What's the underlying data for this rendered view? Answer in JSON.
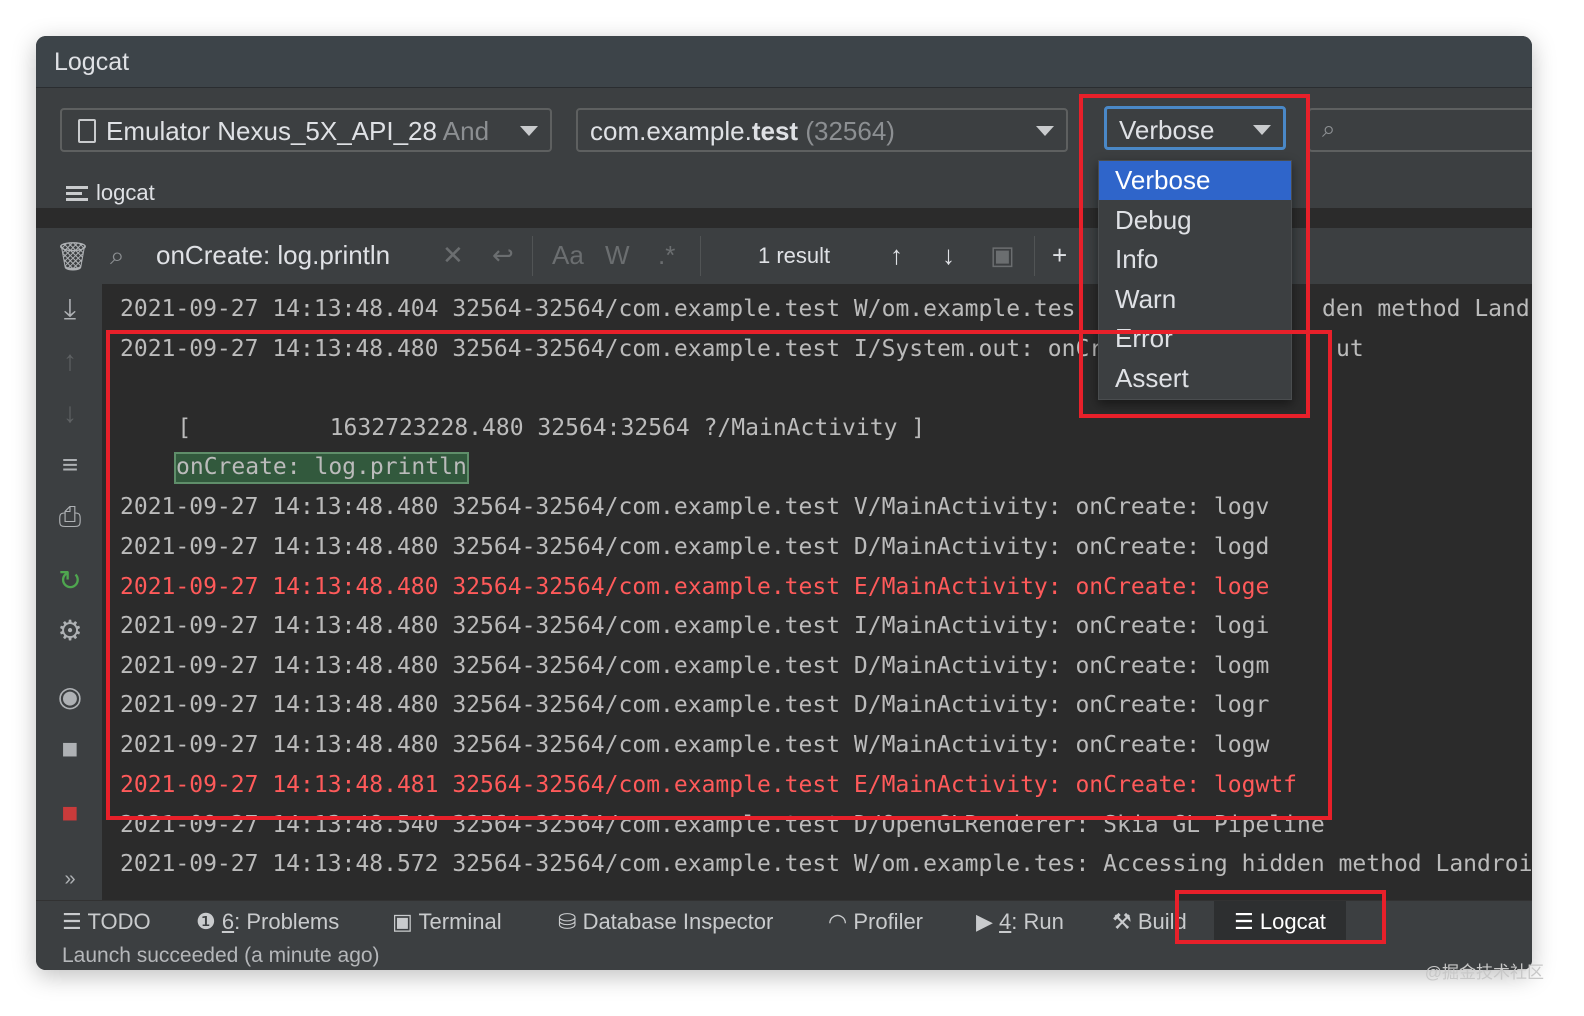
{
  "window": {
    "title": "Logcat"
  },
  "toolbar": {
    "device": "Emulator Nexus_5X_API_28",
    "device_suffix": "And",
    "process_pkg": "com.example.",
    "process_bold": "test",
    "process_pid": "(32564)",
    "log_level": "Verbose"
  },
  "tab": {
    "label": "logcat"
  },
  "search": {
    "query": "onCreate: log.println",
    "match_case": "Aa",
    "words": "W",
    "regex": ".*",
    "results": "1 result"
  },
  "dropdown": {
    "items": [
      "Verbose",
      "Debug",
      "Info",
      "Warn",
      "Error",
      "Assert"
    ],
    "selected": "Verbose"
  },
  "log": {
    "lines": [
      "2021-09-27 14:13:48.404 32564-32564/com.example.test W/om.example.tes",
      "2021-09-27 14:13:48.480 32564-32564/com.example.test I/System.out: onCr",
      "",
      "    [          1632723228.480 32564:32564 ?/MainActivity ]",
      "onCreate: log.println",
      "2021-09-27 14:13:48.480 32564-32564/com.example.test V/MainActivity: onCreate: logv",
      "2021-09-27 14:13:48.480 32564-32564/com.example.test D/MainActivity: onCreate: logd",
      "2021-09-27 14:13:48.480 32564-32564/com.example.test E/MainActivity: onCreate: loge",
      "2021-09-27 14:13:48.480 32564-32564/com.example.test I/MainActivity: onCreate: logi",
      "2021-09-27 14:13:48.480 32564-32564/com.example.test D/MainActivity: onCreate: logm",
      "2021-09-27 14:13:48.480 32564-32564/com.example.test D/MainActivity: onCreate: logr",
      "2021-09-27 14:13:48.480 32564-32564/com.example.test W/MainActivity: onCreate: logw",
      "2021-09-27 14:13:48.481 32564-32564/com.example.test E/MainActivity: onCreate: logwtf",
      "2021-09-27 14:13:48.540 32564-32564/com.example.test D/OpenGLRenderer: Skia GL Pipeline",
      "2021-09-27 14:13:48.572 32564-32564/com.example.test W/om.example.tes: Accessing hidden method Landroi"
    ],
    "line0_tail": "den method Landroi",
    "line1_tail": "ut"
  },
  "bottom_tabs": {
    "todo": "TODO",
    "problems_num": "6",
    "problems": ": Problems",
    "terminal": "Terminal",
    "db": "Database Inspector",
    "profiler": "Profiler",
    "run_num": "4",
    "run": ": Run",
    "build": "Build",
    "logcat": "Logcat"
  },
  "status": {
    "text": "Launch succeeded (a minute ago)"
  },
  "watermark": "@掘金技术社区",
  "colors": {
    "error": "#ff5a5a",
    "selection": "#2f65ca",
    "highlight": "#e8202a"
  }
}
